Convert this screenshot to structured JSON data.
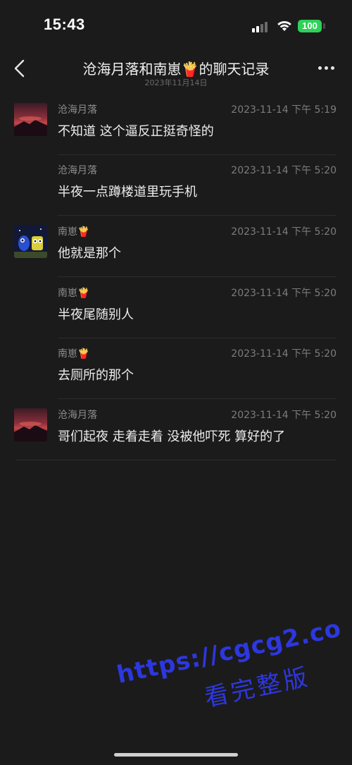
{
  "status_bar": {
    "time": "15:43",
    "battery": "100",
    "icons": [
      "signal-icon",
      "wifi-icon",
      "battery-icon"
    ]
  },
  "nav": {
    "title": "沧海月落和南崽🍟的聊天记录",
    "subtitle": "2023年11月14日",
    "icons": [
      "back-icon",
      "more-icon"
    ]
  },
  "messages": [
    {
      "sender": "沧海月落",
      "time": "2023-11-14 下午 5:19",
      "text": "不知道 这个逼反正挺奇怪的",
      "avatar": "sunset-avatar"
    },
    {
      "sender": "沧海月落",
      "time": "2023-11-14 下午 5:20",
      "text": "半夜一点蹲楼道里玩手机"
    },
    {
      "sender": "南崽🍟",
      "time": "2023-11-14 下午 5:20",
      "text": "他就是那个",
      "avatar": "cartoon-avatar"
    },
    {
      "sender": "南崽🍟",
      "time": "2023-11-14 下午 5:20",
      "text": "半夜尾随别人"
    },
    {
      "sender": "南崽🍟",
      "time": "2023-11-14 下午 5:20",
      "text": "去厕所的那个"
    },
    {
      "sender": "沧海月落",
      "time": "2023-11-14 下午 5:20",
      "text": "哥们起夜 走着走着 没被他吓死 算好的了",
      "avatar": "sunset-avatar"
    }
  ],
  "watermark": {
    "url": "https://cgcg2.co",
    "text": "看完整版"
  },
  "colors": {
    "background": "#1b1b1b",
    "battery": "#2fd158",
    "watermark": "#2d37e0"
  }
}
